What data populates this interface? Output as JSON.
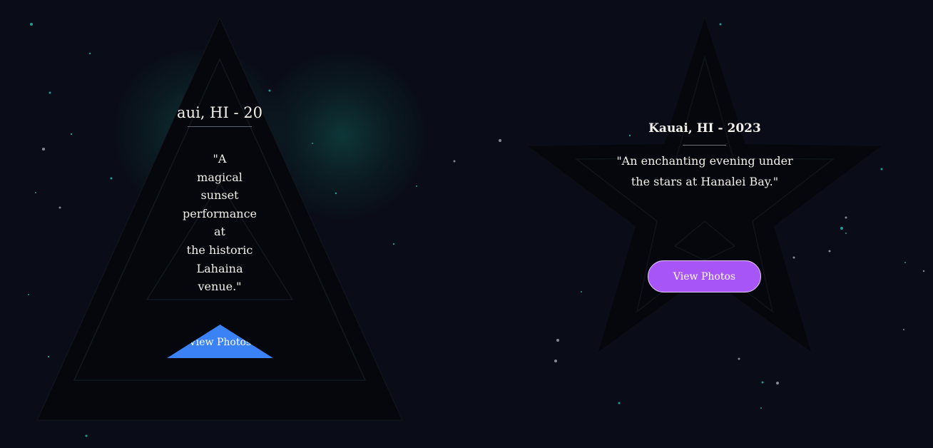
{
  "colors": {
    "background": "#0a0d17",
    "triangle_button": "#3b82f6",
    "star_button": "#a855f7",
    "text": "#f3f0ea"
  },
  "triangle_card": {
    "title": "aui, HI - 20",
    "quote_lines": [
      "\"A",
      "magical",
      "sunset",
      "performance",
      "at",
      "the historic",
      "Lahaina",
      "venue.\""
    ],
    "button_label": "View Photos"
  },
  "star_card": {
    "title": "Kauai, HI - 2023",
    "quote_lines": [
      "\"An enchanting evening under",
      "the stars at Hanalei Bay.\""
    ],
    "button_label": "View Photos"
  }
}
